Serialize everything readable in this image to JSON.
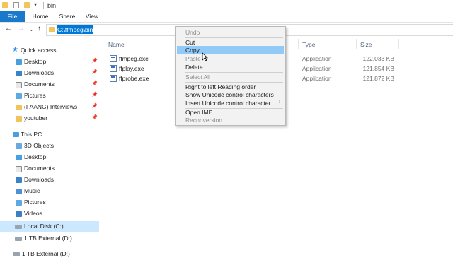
{
  "window": {
    "title": "bin"
  },
  "ribbon": {
    "tabs": [
      "File",
      "Home",
      "Share",
      "View"
    ]
  },
  "quick_access_toolbar": {
    "dropdown": "▾"
  },
  "nav": {
    "back": "←",
    "forward": "→",
    "recent": "⌄",
    "up": "↑"
  },
  "address": {
    "path": "C:\\ffmpeg\\bin"
  },
  "sidebar": {
    "quick_access": "Quick access",
    "pinned": [
      {
        "label": "Desktop",
        "pin": "📌"
      },
      {
        "label": "Downloads",
        "pin": "📌"
      },
      {
        "label": "Documents",
        "pin": "📌"
      },
      {
        "label": "Pictures",
        "pin": "📌"
      },
      {
        "label": "(FAANG) Interviews",
        "pin": "📌"
      },
      {
        "label": "youtuber",
        "pin": "📌"
      }
    ],
    "this_pc": "This PC",
    "pc_items": [
      "3D Objects",
      "Desktop",
      "Documents",
      "Downloads",
      "Music",
      "Pictures",
      "Videos"
    ],
    "drives": [
      "Local Disk (C:)",
      "1 TB External (D:)",
      "1 TB External (D:)"
    ]
  },
  "file_list": {
    "columns": {
      "name": "Name",
      "type": "Type",
      "size": "Size"
    },
    "rows": [
      {
        "name": "ffmpeg.exe",
        "type": "Application",
        "size": "122,033 KB"
      },
      {
        "name": "ffplay.exe",
        "type": "Application",
        "size": "121,854 KB"
      },
      {
        "name": "ffprobe.exe",
        "type": "Application",
        "size": "121,872 KB"
      }
    ]
  },
  "context_menu": {
    "undo": "Undo",
    "cut": "Cut",
    "copy": "Copy",
    "paste": "Paste",
    "delete": "Delete",
    "select_all": "Select All",
    "rtl": "Right to left Reading order",
    "show_unicode": "Show Unicode control characters",
    "insert_unicode": "Insert Unicode control character",
    "submenu_arrow": "›",
    "open_ime": "Open IME",
    "reconversion": "Reconversion"
  },
  "colors": {
    "accent": "#1979ca",
    "selection": "#0078d7",
    "highlight": "#91c9f7",
    "sidebar_selected": "#cce8ff",
    "folder": "#f2c55c"
  }
}
